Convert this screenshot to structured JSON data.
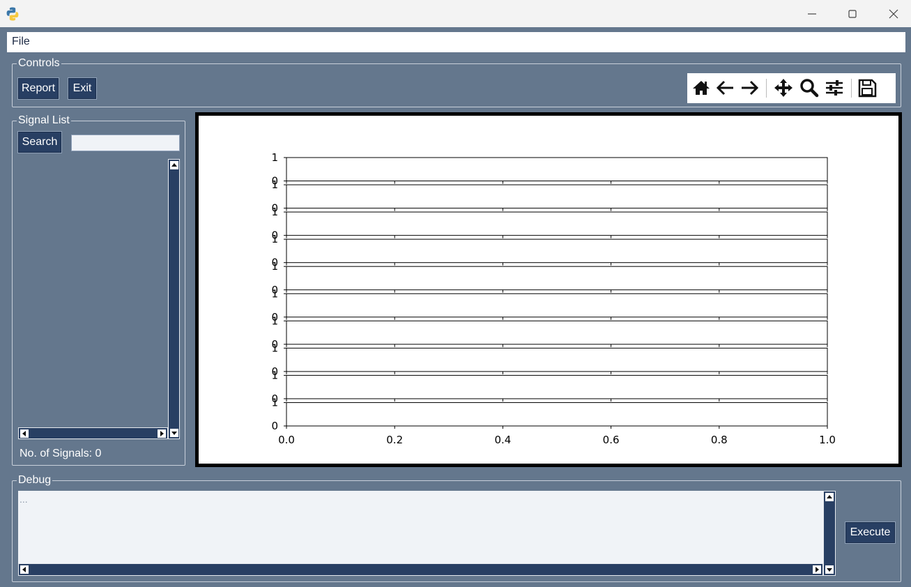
{
  "window": {
    "icon": "python-icon",
    "controls": [
      "minimize-icon",
      "maximize-icon",
      "close-icon"
    ]
  },
  "menu": {
    "file_label": "File"
  },
  "controls_frame": {
    "label": "Controls",
    "report_label": "Report",
    "exit_label": "Exit"
  },
  "nav_toolbar": {
    "icons": [
      "home-icon",
      "back-icon",
      "forward-icon",
      "pan-icon",
      "zoom-icon",
      "configure-subplots-icon",
      "save-icon"
    ]
  },
  "signal_list": {
    "label": "Signal List",
    "search_label": "Search",
    "search_value": "",
    "count_text": "No. of Signals: 0"
  },
  "debug": {
    "label": "Debug",
    "text": "...",
    "execute_label": "Execute"
  },
  "chart_data": {
    "type": "line",
    "subplot_count": 10,
    "series": [],
    "ylim": [
      0,
      1
    ],
    "ytick_labels": [
      "0",
      "1"
    ],
    "xlim": [
      0.0,
      1.0
    ],
    "xticks": [
      0.0,
      0.2,
      0.4,
      0.6,
      0.8,
      1.0
    ],
    "xtick_labels": [
      "0.0",
      "0.2",
      "0.4",
      "0.6",
      "0.8",
      "1.0"
    ],
    "title": "",
    "xlabel": "",
    "ylabel": ""
  }
}
